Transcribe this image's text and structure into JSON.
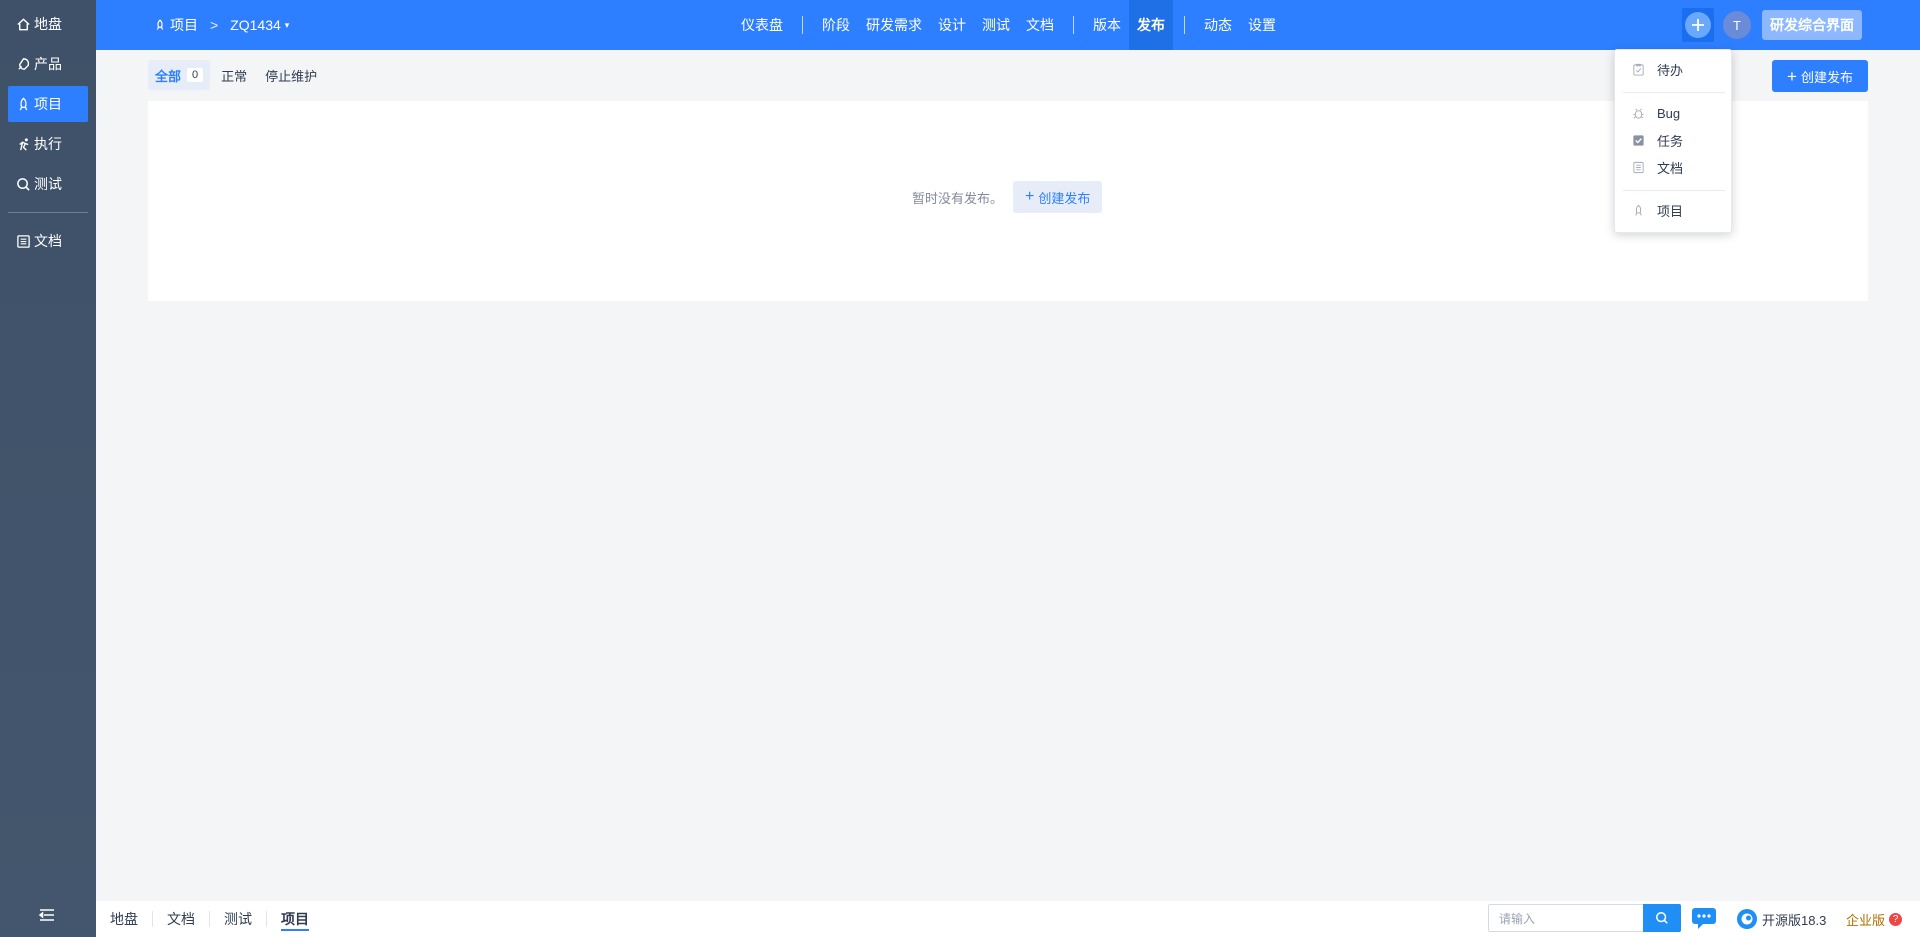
{
  "sidebar": {
    "items": [
      {
        "label": "地盘",
        "icon": "home-icon"
      },
      {
        "label": "产品",
        "icon": "product-icon"
      },
      {
        "label": "项目",
        "icon": "project-icon",
        "active": true
      },
      {
        "label": "执行",
        "icon": "execution-icon"
      },
      {
        "label": "测试",
        "icon": "test-icon"
      },
      {
        "label": "文档",
        "icon": "doc-icon"
      }
    ]
  },
  "header": {
    "breadcrumb": {
      "root": "项目",
      "separator": ">",
      "current": "ZQ1434",
      "caret": "▾"
    },
    "nav": [
      {
        "label": "仪表盘"
      },
      {
        "label": "阶段"
      },
      {
        "label": "研发需求"
      },
      {
        "label": "设计"
      },
      {
        "label": "测试"
      },
      {
        "label": "文档"
      },
      {
        "label": "版本"
      },
      {
        "label": "发布",
        "active": true
      },
      {
        "label": "动态"
      },
      {
        "label": "设置"
      }
    ],
    "avatar_letter": "T",
    "mode_button": "研发综合界面"
  },
  "subtabs": {
    "all": {
      "label": "全部",
      "count": "0"
    },
    "normal": "正常",
    "terminated": "停止维护"
  },
  "actions": {
    "create_release": "创建发布",
    "plus": "+"
  },
  "empty": {
    "message": "暂时没有发布。",
    "button": "创建发布"
  },
  "dropdown": {
    "items": [
      {
        "label": "待办",
        "icon": "todo-icon"
      },
      {
        "label": "Bug",
        "icon": "bug-icon"
      },
      {
        "label": "任务",
        "icon": "task-icon"
      },
      {
        "label": "文档",
        "icon": "doc-icon"
      },
      {
        "label": "项目",
        "icon": "project-icon"
      }
    ]
  },
  "footer": {
    "links": [
      {
        "label": "地盘"
      },
      {
        "label": "文档"
      },
      {
        "label": "测试"
      },
      {
        "label": "项目",
        "active": true
      }
    ],
    "search_placeholder": "请输入",
    "version": "开源版18.3",
    "enterprise": "企业版",
    "enterprise_badge": "?"
  },
  "colors": {
    "primary": "#2e7fff",
    "sidebar": "#3e5168",
    "active_tab": "#1f6fe6"
  }
}
